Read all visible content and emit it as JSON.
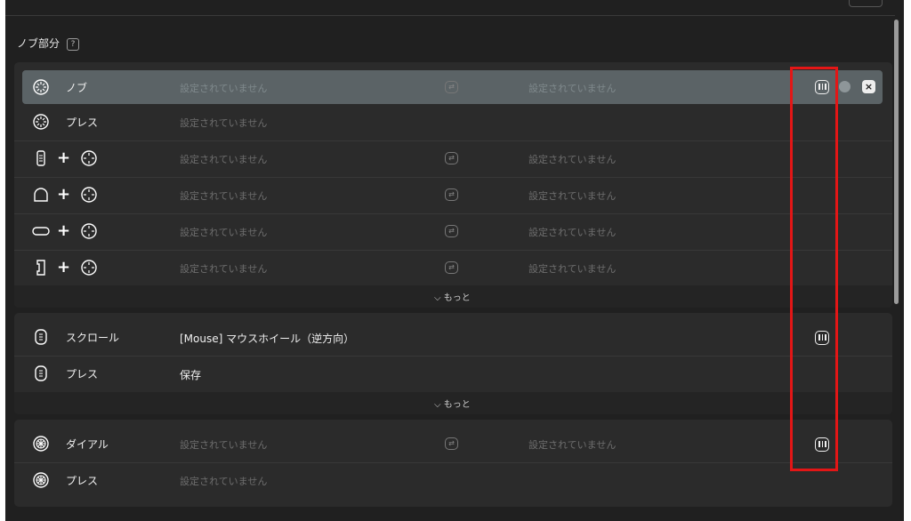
{
  "header": {
    "title": ""
  },
  "section": {
    "title": "ノブ部分",
    "help": "?"
  },
  "knob_rows": [
    {
      "label": "ノブ",
      "icon": "knob-icon",
      "action": "設定されていません",
      "action2": "設定されていません",
      "selected": true
    },
    {
      "label": "プレス",
      "icon": "knob-icon",
      "action": "設定されていません"
    },
    {
      "label": "",
      "icon": "bar-key-icon",
      "action": "設定されていません",
      "action2": "設定されていません"
    },
    {
      "label": "",
      "icon": "arch-key-icon",
      "action": "設定されていません",
      "action2": "設定されていません"
    },
    {
      "label": "",
      "icon": "pill-key-icon",
      "action": "設定されていません",
      "action2": "設定されていません"
    },
    {
      "label": "",
      "icon": "bracket-key-icon",
      "action": "設定されていません",
      "action2": "設定されていません"
    }
  ],
  "scroll_rows": [
    {
      "label": "スクロール",
      "icon": "scroll-wheel-icon",
      "action": "[Mouse] マウスホイール（逆方向）"
    },
    {
      "label": "プレス",
      "icon": "scroll-wheel-icon",
      "action": "保存"
    }
  ],
  "dial_rows": [
    {
      "label": "ダイアル",
      "icon": "dial-icon",
      "action": "設定されていません",
      "action2": "設定されていません"
    },
    {
      "label": "プレス",
      "icon": "dial-icon",
      "action": "設定されていません"
    }
  ],
  "more_label": "もっと",
  "plus": "+",
  "swap_icon": "swap-icon",
  "close_label": "×",
  "highlight_color": "#e31616"
}
